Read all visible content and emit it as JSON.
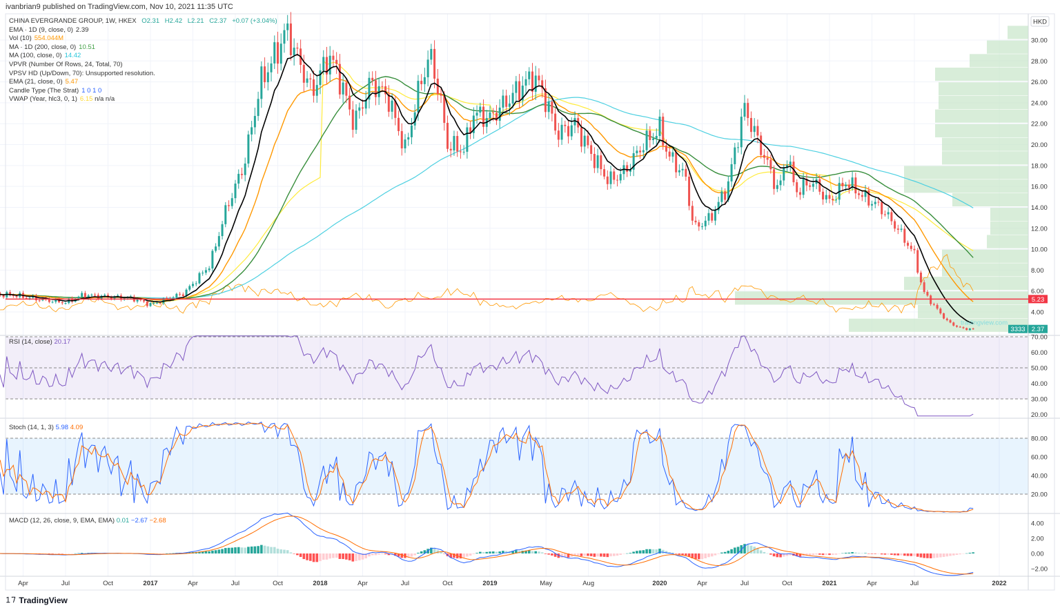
{
  "header": {
    "published": "ivanbrian9 published on TradingView.com, Nov 10, 2021 11:35 UTC"
  },
  "legend": {
    "symbol": "CHINA EVERGRANDE GROUP, 1W, HKEX",
    "o": "O2.31",
    "h": "H2.42",
    "l": "L2.21",
    "c": "C2.37",
    "chg": "+0.07 (+3.04%)",
    "rows": [
      {
        "name": "EMA · 1D (9, close, 0)",
        "val": "2.39",
        "color": "#333333"
      },
      {
        "name": "Vol (10)",
        "val": "554.044M",
        "color": "#ff9800"
      },
      {
        "name": "MA · 1D (200, close, 0)",
        "val": "10.51",
        "color": "#43a047"
      },
      {
        "name": "MA (100, close, 0)",
        "val": "14.42",
        "color": "#26c6da"
      },
      {
        "name": "VPVR (Number Of Rows, 24, Total, 70)",
        "val": "",
        "color": "#333333"
      },
      {
        "name": "VPSV HD (Up/Down, 70): Unsupported resolution.",
        "val": "",
        "color": "#333333"
      },
      {
        "name": "EMA (21, close, 0)",
        "val": "5.47",
        "color": "#ff9800"
      },
      {
        "name": "Candle Type (The Strat)",
        "val": "1  0  1  0",
        "color": "#2962ff"
      },
      {
        "name": "VWAP (Year, hlc3, 0, 1)",
        "val": "6.15",
        "extra": "n/a  n/a",
        "color": "#fdd835"
      }
    ]
  },
  "panes": {
    "rsi": {
      "label": "RSI (14, close)",
      "val": "20.17",
      "ticks": [
        "70.00",
        "60.00",
        "50.00",
        "40.00",
        "30.00",
        "20.00"
      ]
    },
    "stoch": {
      "label": "Stoch (14, 1, 3)",
      "k": "5.98",
      "d": "4.09",
      "ticks": [
        "80.00",
        "60.00",
        "40.00",
        "20.00"
      ]
    },
    "macd": {
      "label": "MACD (12, 26, close, 9, EMA, EMA)",
      "hist": "0.01",
      "macd": "−2.67",
      "signal": "−2.68",
      "ticks": [
        "4.00",
        "2.00",
        "0.00",
        "−2.00"
      ]
    }
  },
  "footer": {
    "brand": "TradingView"
  },
  "chart_data": {
    "type": "candlestick",
    "title": "CHINA EVERGRANDE GROUP, 1W, HKEX",
    "currency": "HKD",
    "price_ticks": [
      "4.00",
      "6.00",
      "8.00",
      "10.00",
      "12.00",
      "14.00",
      "16.00",
      "18.00",
      "20.00",
      "22.00",
      "24.00",
      "26.00",
      "28.00",
      "30.00"
    ],
    "ylim": [
      2,
      32
    ],
    "x_ticks": [
      {
        "t": 2016.25,
        "label": "Apr"
      },
      {
        "t": 2016.5,
        "label": "Jul"
      },
      {
        "t": 2016.75,
        "label": "Oct"
      },
      {
        "t": 2017,
        "label": "2017"
      },
      {
        "t": 2017.25,
        "label": "Apr"
      },
      {
        "t": 2017.5,
        "label": "Jul"
      },
      {
        "t": 2017.75,
        "label": "Oct"
      },
      {
        "t": 2018,
        "label": "2018"
      },
      {
        "t": 2018.25,
        "label": "Apr"
      },
      {
        "t": 2018.5,
        "label": "Jul"
      },
      {
        "t": 2018.75,
        "label": "Oct"
      },
      {
        "t": 2019,
        "label": "2019"
      },
      {
        "t": 2019.33,
        "label": "May"
      },
      {
        "t": 2019.58,
        "label": "Aug"
      },
      {
        "t": 2020,
        "label": "2020"
      },
      {
        "t": 2020.25,
        "label": "Apr"
      },
      {
        "t": 2020.5,
        "label": "Jul"
      },
      {
        "t": 2020.75,
        "label": "Oct"
      },
      {
        "t": 2021,
        "label": "2021"
      },
      {
        "t": 2021.25,
        "label": "Apr"
      },
      {
        "t": 2021.5,
        "label": "Jul"
      },
      {
        "t": 2022,
        "label": "2022"
      }
    ],
    "close_keypoints": [
      [
        2016.0,
        5.7
      ],
      [
        2016.2,
        5.6
      ],
      [
        2016.35,
        5.2
      ],
      [
        2016.5,
        4.9
      ],
      [
        2016.6,
        5.6
      ],
      [
        2016.9,
        5.3
      ],
      [
        2017.0,
        4.7
      ],
      [
        2017.2,
        5.8
      ],
      [
        2017.35,
        8.5
      ],
      [
        2017.45,
        14
      ],
      [
        2017.55,
        18
      ],
      [
        2017.65,
        26
      ],
      [
        2017.75,
        29
      ],
      [
        2017.8,
        31
      ],
      [
        2017.9,
        27
      ],
      [
        2017.95,
        25
      ],
      [
        2018.05,
        28.5
      ],
      [
        2018.1,
        27
      ],
      [
        2018.2,
        22
      ],
      [
        2018.3,
        26
      ],
      [
        2018.4,
        24.5
      ],
      [
        2018.5,
        19.5
      ],
      [
        2018.6,
        26.5
      ],
      [
        2018.65,
        28.5
      ],
      [
        2018.7,
        25
      ],
      [
        2018.75,
        20
      ],
      [
        2018.85,
        19.5
      ],
      [
        2018.9,
        23
      ],
      [
        2019.0,
        22.5
      ],
      [
        2019.15,
        25
      ],
      [
        2019.25,
        26.5
      ],
      [
        2019.3,
        25.5
      ],
      [
        2019.4,
        21
      ],
      [
        2019.5,
        22
      ],
      [
        2019.6,
        19
      ],
      [
        2019.7,
        16.5
      ],
      [
        2019.8,
        17.5
      ],
      [
        2019.9,
        20
      ],
      [
        2020.0,
        21.5
      ],
      [
        2020.05,
        19
      ],
      [
        2020.15,
        17
      ],
      [
        2020.2,
        12
      ],
      [
        2020.3,
        13
      ],
      [
        2020.4,
        16
      ],
      [
        2020.45,
        20
      ],
      [
        2020.5,
        23.5
      ],
      [
        2020.55,
        21.5
      ],
      [
        2020.6,
        19.5
      ],
      [
        2020.7,
        15.5
      ],
      [
        2020.75,
        19
      ],
      [
        2020.8,
        15.5
      ],
      [
        2020.9,
        16.5
      ],
      [
        2021.0,
        14.5
      ],
      [
        2021.1,
        16.5
      ],
      [
        2021.2,
        15
      ],
      [
        2021.3,
        14
      ],
      [
        2021.4,
        12
      ],
      [
        2021.5,
        9.5
      ],
      [
        2021.55,
        6
      ],
      [
        2021.62,
        4.5
      ],
      [
        2021.7,
        3
      ],
      [
        2021.78,
        2.4
      ],
      [
        2021.86,
        2.37
      ]
    ],
    "hline": {
      "value": 5.23,
      "label": "5.23",
      "color": "#f23645"
    },
    "last": {
      "value": 2.37,
      "label": "2.37",
      "countdown": "3333"
    },
    "volume_profile_rows": [
      [
        30.7,
        30
      ],
      [
        29.3,
        60
      ],
      [
        28,
        85
      ],
      [
        26.7,
        135
      ],
      [
        25.3,
        130
      ],
      [
        24,
        130
      ],
      [
        22.7,
        135
      ],
      [
        21.3,
        135
      ],
      [
        20,
        125
      ],
      [
        18.7,
        125
      ],
      [
        17.3,
        180
      ],
      [
        16,
        180
      ],
      [
        14.7,
        110
      ],
      [
        13.3,
        55
      ],
      [
        12,
        55
      ],
      [
        10.7,
        60
      ],
      [
        9.3,
        125
      ],
      [
        8,
        125
      ],
      [
        6.7,
        180
      ],
      [
        5.3,
        425
      ],
      [
        4,
        160
      ],
      [
        2.7,
        260
      ]
    ],
    "colors": {
      "up": "#26a69a",
      "down": "#ef5350",
      "ema9": "#000000",
      "ema21": "#ff9800",
      "ma200": "#388e3c",
      "ma100": "#4dd0e1",
      "vwap": "#ffeb3b",
      "vol": "#ff9800",
      "rsi": "#7e57c2",
      "stochK": "#2962ff",
      "stochD": "#ff6d00",
      "vp": "#c8e6c9"
    },
    "watermark": "tradingview.com"
  }
}
